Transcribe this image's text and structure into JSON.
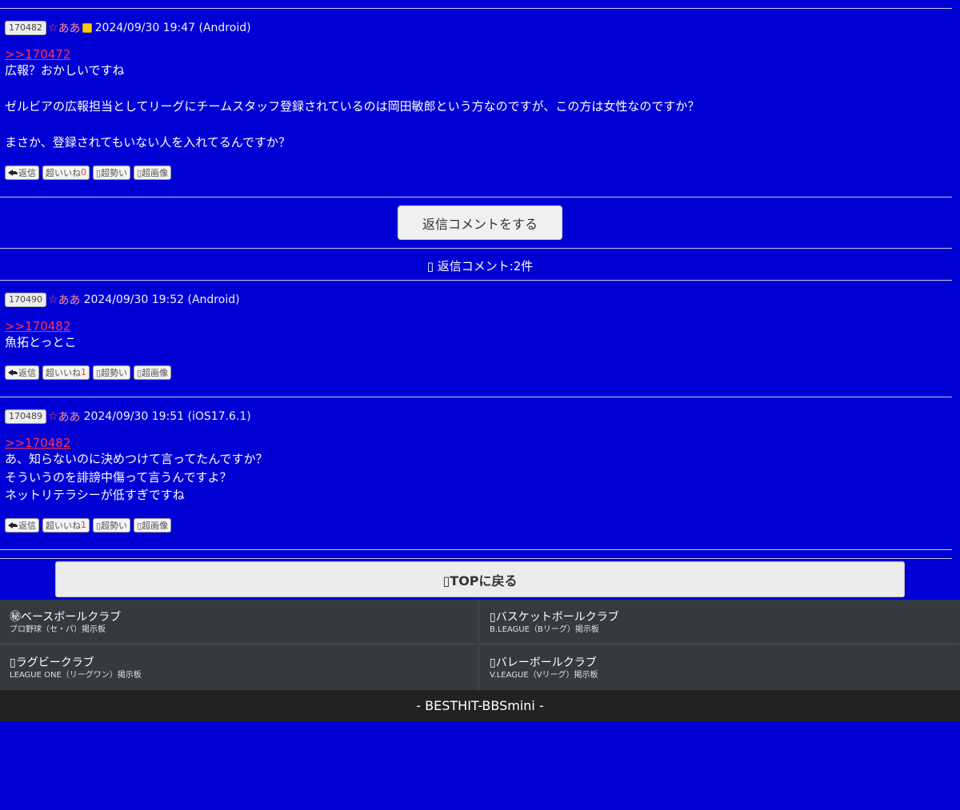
{
  "posts": [
    {
      "id": "170482",
      "star": "☆",
      "author": "ああ",
      "datetime": "2024/09/30 19:47 (Android)",
      "anchor": ">>170472",
      "lines": [
        "広報？おかしいですね",
        "",
        "ゼルビアの広報担当としてリーグにチームスタッフ登録されているのは岡田敏郎という方なのですが、この方は女性なのですか？",
        "",
        "まさか、登録されてもいない人を入れてるんですか？"
      ],
      "actions": {
        "reply": "返信",
        "like": "超いいね",
        "like_count": "0",
        "hot": "▯超勢い",
        "image": "▯超画像"
      }
    },
    {
      "id": "170490",
      "star": "☆",
      "author": "ああ",
      "datetime": "2024/09/30 19:52 (Android)",
      "anchor": ">>170482",
      "lines": [
        "魚拓とっとこ"
      ],
      "actions": {
        "reply": "返信",
        "like": "超いいね",
        "like_count": "1",
        "hot": "▯超勢い",
        "image": "▯超画像"
      }
    },
    {
      "id": "170489",
      "star": "☆",
      "author": "ああ",
      "datetime": "2024/09/30 19:51 (iOS17.6.1)",
      "anchor": ">>170482",
      "lines": [
        "あ、知らないのに決めつけて言ってたんですか？",
        "そういうのを誹謗中傷って言うんですよ？",
        "ネットリテラシーが低すぎですね"
      ],
      "actions": {
        "reply": "返信",
        "like": "超いいね",
        "like_count": "1",
        "hot": "▯超勢い",
        "image": "▯超画像"
      }
    }
  ],
  "reply_button": "返信コメントをする",
  "reply_count": "▯ 返信コメント:2件",
  "top_button": "▯TOPに戻る",
  "clubs": [
    {
      "name": "㊙ベースボールクラブ",
      "sub": "プロ野球（セ・パ）掲示板"
    },
    {
      "name": "▯バスケットボールクラブ",
      "sub": "B.LEAGUE（Bリーグ）掲示板"
    },
    {
      "name": "▯ラグビークラブ",
      "sub": "LEAGUE ONE（リーグワン）掲示板"
    },
    {
      "name": "▯バレーボールクラブ",
      "sub": "V.LEAGUE（Vリーグ）掲示板"
    }
  ],
  "footer": "- BESTHIT-BBSmini -",
  "colors": {
    "background": "#0000d5",
    "anchor": "#ff3355",
    "star": "#ff5a5a",
    "badge": "#ffcc00"
  }
}
